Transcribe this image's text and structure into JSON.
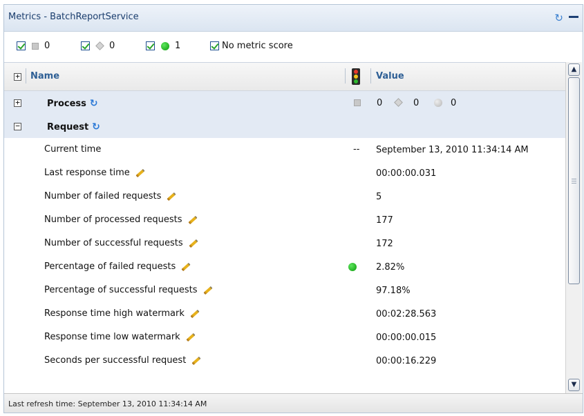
{
  "panel": {
    "title": "Metrics - BatchReportService",
    "refresh_icon": "refresh-icon",
    "minimize_icon": "minimize-icon"
  },
  "filters": [
    {
      "count": "0",
      "icon": "gray-square"
    },
    {
      "count": "0",
      "icon": "gray-diamond"
    },
    {
      "count": "1",
      "icon": "green-circle"
    },
    {
      "label": "No metric score"
    }
  ],
  "columns": {
    "name": "Name",
    "value": "Value"
  },
  "groups": {
    "process": {
      "label": "Process",
      "counts": [
        "0",
        "0",
        "0"
      ]
    },
    "request": {
      "label": "Request"
    }
  },
  "rows": [
    {
      "name": "Current time",
      "status": "--",
      "value": "September 13, 2010 11:34:14 AM",
      "editable": false
    },
    {
      "name": "Last response time",
      "value": "00:00:00.031",
      "editable": true
    },
    {
      "name": "Number of failed requests",
      "value": "5",
      "editable": true
    },
    {
      "name": "Number of processed requests",
      "value": "177",
      "editable": true
    },
    {
      "name": "Number of successful requests",
      "value": "172",
      "editable": true
    },
    {
      "name": "Percentage of failed requests",
      "status": "green",
      "value": "2.82%",
      "editable": true
    },
    {
      "name": "Percentage of successful requests",
      "value": "97.18%",
      "editable": true
    },
    {
      "name": "Response time high watermark",
      "value": "00:02:28.563",
      "editable": true
    },
    {
      "name": "Response time low watermark",
      "value": "00:00:00.015",
      "editable": true
    },
    {
      "name": "Seconds per successful request",
      "value": "00:00:16.229",
      "editable": true
    }
  ],
  "footer": {
    "text": "Last refresh time: September 13, 2010 11:34:14 AM"
  },
  "colors": {
    "header_text": "#2e5f95",
    "group_bg": "#e3eaf4",
    "status_green": "#0a9a0a"
  }
}
